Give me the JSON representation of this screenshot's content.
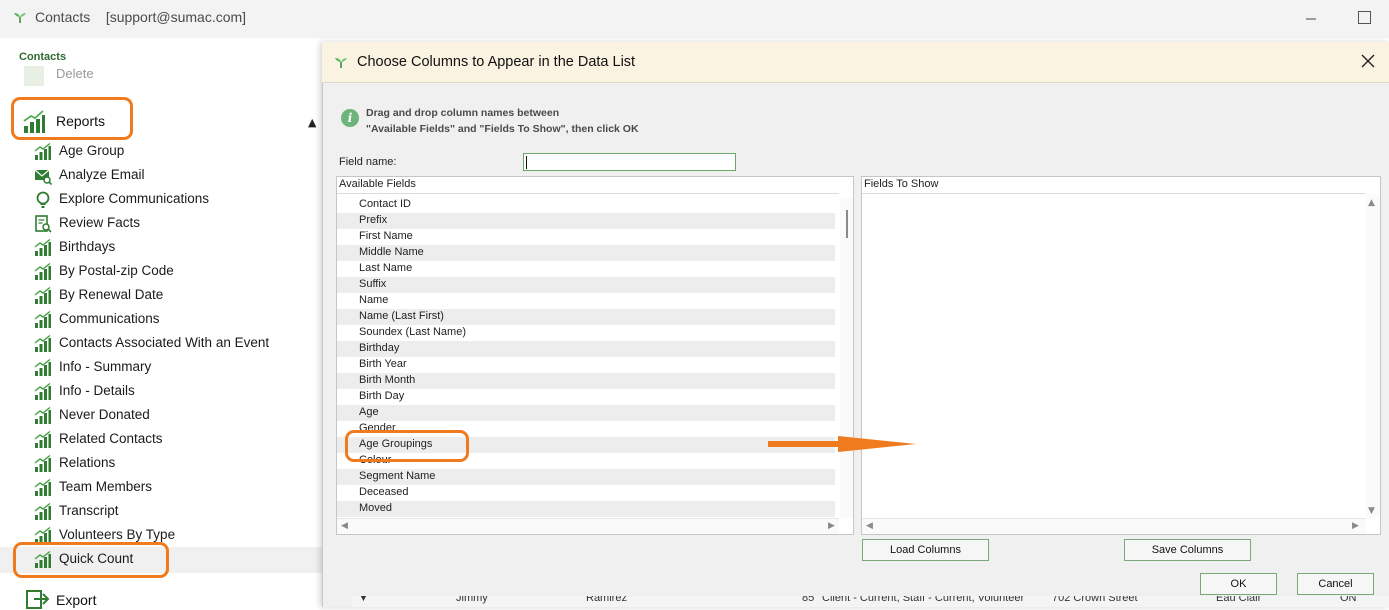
{
  "window": {
    "app_name": "Contacts",
    "account": "[support@sumac.com]",
    "icons": {
      "app": "sumac-logo-icon",
      "minimize": "minimize-icon",
      "maximize": "maximize-icon"
    }
  },
  "sidebar": {
    "section_label": "Contacts",
    "delete_label": "Delete",
    "reports_label": "Reports",
    "items": [
      {
        "label": "Age Group",
        "icon": "bar-chart-icon"
      },
      {
        "label": "Analyze Email",
        "icon": "email-search-icon"
      },
      {
        "label": "Explore Communications",
        "icon": "lightbulb-icon"
      },
      {
        "label": "Review Facts",
        "icon": "document-search-icon"
      },
      {
        "label": "Birthdays",
        "icon": "bar-chart-icon"
      },
      {
        "label": "By Postal-zip Code",
        "icon": "bar-chart-icon"
      },
      {
        "label": "By Renewal Date",
        "icon": "bar-chart-icon"
      },
      {
        "label": "Communications",
        "icon": "bar-chart-icon"
      },
      {
        "label": "Contacts Associated With an Event",
        "icon": "bar-chart-icon"
      },
      {
        "label": "Info - Summary",
        "icon": "bar-chart-icon"
      },
      {
        "label": "Info - Details",
        "icon": "bar-chart-icon"
      },
      {
        "label": "Never Donated",
        "icon": "bar-chart-icon"
      },
      {
        "label": "Related Contacts",
        "icon": "bar-chart-icon"
      },
      {
        "label": "Relations",
        "icon": "bar-chart-icon"
      },
      {
        "label": "Team Members",
        "icon": "bar-chart-icon"
      },
      {
        "label": "Transcript",
        "icon": "bar-chart-icon"
      },
      {
        "label": "Volunteers By Type",
        "icon": "bar-chart-icon"
      },
      {
        "label": "Quick Count",
        "icon": "bar-chart-icon",
        "selected": true
      }
    ],
    "export_label": "Export"
  },
  "dialog": {
    "title": "Choose Columns to Appear in the Data List",
    "info_line1": "Drag and drop column names between",
    "info_line2": "\"Available Fields\" and \"Fields To Show\", then click OK",
    "field_name_label": "Field name:",
    "field_name_value": "",
    "available_header": "Available Fields",
    "show_header": "Fields To Show",
    "available_fields": [
      "Contact ID",
      "Prefix",
      "First Name",
      "Middle Name",
      "Last Name",
      "Suffix",
      "Name",
      "Name (Last First)",
      "Soundex (Last Name)",
      "Birthday",
      "Birth Year",
      "Birth Month",
      "Birth Day",
      "Age",
      "Gender",
      "Age Groupings",
      "Colour",
      "Segment Name",
      "Deceased",
      "Moved"
    ],
    "fields_to_show": [],
    "buttons": {
      "load": "Load Columns",
      "save": "Save Columns",
      "ok": "OK",
      "cancel": "Cancel"
    }
  },
  "background_row": {
    "cells": [
      "Jimmy",
      "Ramirez",
      "85",
      "Client - Current, Staff - Current, Volunteer",
      "702 Crown Street",
      "Eau Clair",
      "ON"
    ]
  },
  "colors": {
    "highlight": "#f07a1e",
    "accent_green": "#4caf50",
    "dialog_header": "#fbf3e2"
  }
}
